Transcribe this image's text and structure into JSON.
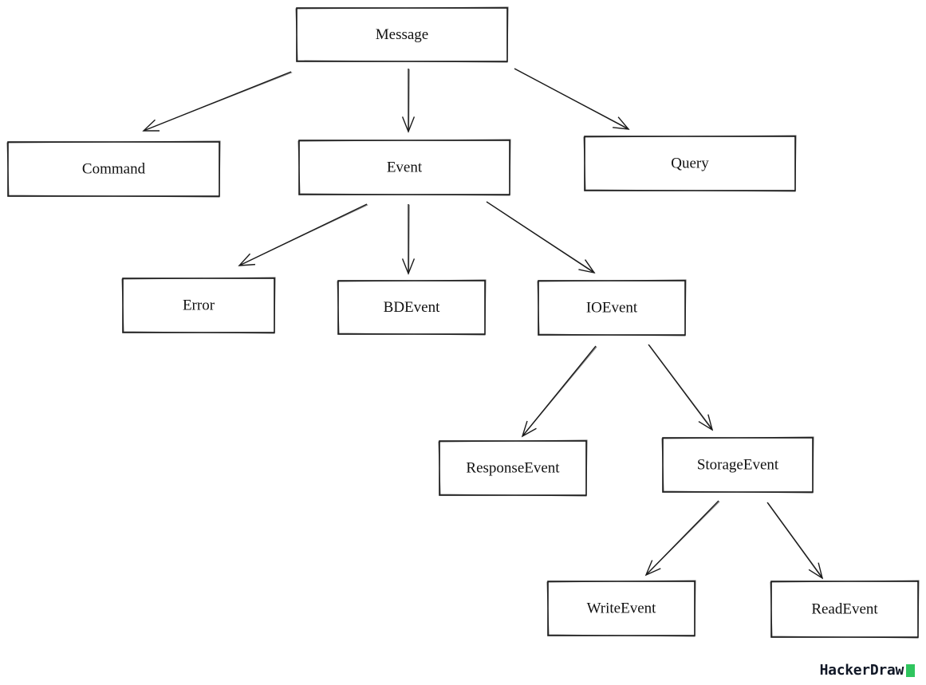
{
  "diagram": {
    "nodes": [
      {
        "id": "message",
        "label": "Message"
      },
      {
        "id": "command",
        "label": "Command"
      },
      {
        "id": "event",
        "label": "Event"
      },
      {
        "id": "query",
        "label": "Query"
      },
      {
        "id": "error",
        "label": "Error"
      },
      {
        "id": "bdevent",
        "label": "BDEvent"
      },
      {
        "id": "ioevent",
        "label": "IOEvent"
      },
      {
        "id": "responseevent",
        "label": "ResponseEvent"
      },
      {
        "id": "storageevent",
        "label": "StorageEvent"
      },
      {
        "id": "writeevent",
        "label": "WriteEvent"
      },
      {
        "id": "readevent",
        "label": "ReadEvent"
      }
    ],
    "edges": [
      {
        "from": "message",
        "to": "command"
      },
      {
        "from": "message",
        "to": "event"
      },
      {
        "from": "message",
        "to": "query"
      },
      {
        "from": "event",
        "to": "error"
      },
      {
        "from": "event",
        "to": "bdevent"
      },
      {
        "from": "event",
        "to": "ioevent"
      },
      {
        "from": "ioevent",
        "to": "responseevent"
      },
      {
        "from": "ioevent",
        "to": "storageevent"
      },
      {
        "from": "storageevent",
        "to": "writeevent"
      },
      {
        "from": "storageevent",
        "to": "readevent"
      }
    ]
  },
  "branding": {
    "text": "HackerDraw",
    "accent_color": "#2fc55e"
  }
}
